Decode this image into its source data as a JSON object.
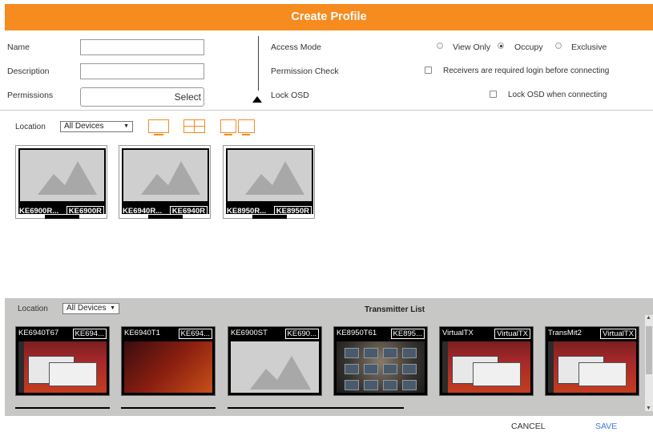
{
  "header": {
    "title": "Create Profile"
  },
  "form": {
    "name_label": "Name",
    "description_label": "Description",
    "permissions_label": "Permissions",
    "select_button": "Select",
    "name_value": "",
    "description_value": ""
  },
  "access": {
    "access_mode_label": "Access Mode",
    "options": [
      "View Only",
      "Occupy",
      "Exclusive"
    ],
    "selected": "Occupy",
    "permission_check_label": "Permission Check",
    "permission_check_text": "Receivers are required login before connecting",
    "lock_osd_label": "Lock OSD",
    "lock_osd_text": "Lock OSD when connecting"
  },
  "receivers": {
    "location_label": "Location",
    "location_value": "All Devices",
    "items": [
      {
        "name": "KE6900R...",
        "badge": "KE6900R"
      },
      {
        "name": "KE6940R...",
        "badge": "KE6940R"
      },
      {
        "name": "KE8950R...",
        "badge": "KE8950R"
      }
    ]
  },
  "transmitters": {
    "location_label": "Location",
    "location_value": "All Devices",
    "title": "Transmitter List",
    "items": [
      {
        "name": "KE6940T67",
        "badge": "KE694...",
        "thumb": "ubuntu"
      },
      {
        "name": "KE6940T1",
        "badge": "KE694...",
        "thumb": "orange"
      },
      {
        "name": "KE6900ST",
        "badge": "KE690...",
        "thumb": "blank"
      },
      {
        "name": "KE8950T61",
        "badge": "KE895...",
        "thumb": "osd"
      },
      {
        "name": "VirtualTX",
        "badge": "VirtualTX",
        "thumb": "ubuntu"
      },
      {
        "name": "TransMit2",
        "badge": "VirtualTX",
        "thumb": "ubuntu"
      }
    ]
  },
  "footer": {
    "cancel": "CANCEL",
    "save": "SAVE"
  },
  "colors": {
    "accent": "#f68b1f",
    "link": "#3a7fd0"
  }
}
